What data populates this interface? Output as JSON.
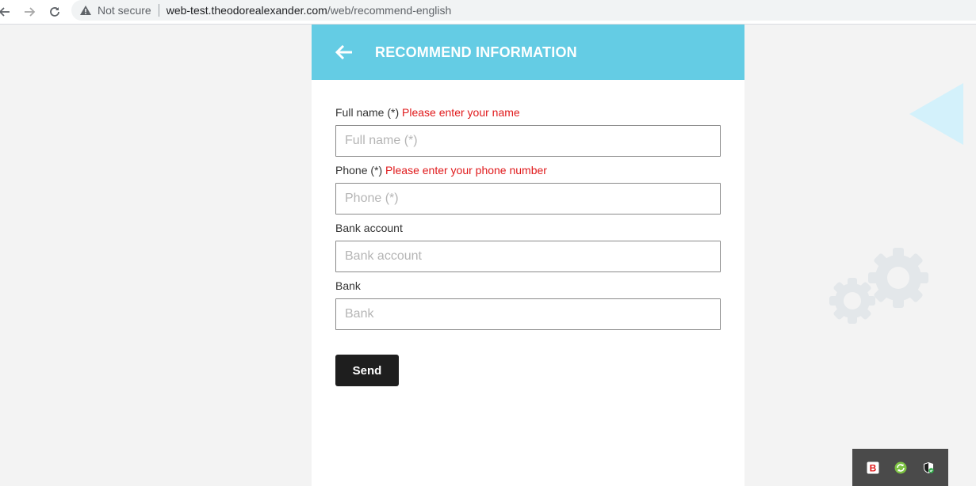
{
  "browser": {
    "security_label": "Not secure",
    "url_host": "web-test.theodorealexander.com",
    "url_path": "/web/recommend-english",
    "icons": [
      "back-arrow-icon",
      "forward-arrow-icon",
      "reload-icon",
      "warning-icon"
    ]
  },
  "header": {
    "title": "RECOMMEND INFORMATION",
    "back_icon": "arrow-left-icon",
    "background": "#64cce4"
  },
  "form": {
    "fields": [
      {
        "label": "Full name (*)",
        "error": "Please enter your name",
        "placeholder": "Full name (*)",
        "value": ""
      },
      {
        "label": "Phone (*)",
        "error": "Please enter your phone number",
        "placeholder": "Phone (*)",
        "value": ""
      },
      {
        "label": "Bank account",
        "error": "",
        "placeholder": "Bank account",
        "value": ""
      },
      {
        "label": "Bank",
        "error": "",
        "placeholder": "Bank",
        "value": ""
      }
    ],
    "submit_label": "Send"
  },
  "tray": {
    "icons": [
      "brave-b-icon",
      "sync-icon",
      "shield-check-icon"
    ],
    "brave_letter": "B"
  },
  "colors": {
    "accent": "#64cce4",
    "error": "#e0191b",
    "button": "#1e1e1e",
    "page_bg": "#f3f3f3"
  }
}
